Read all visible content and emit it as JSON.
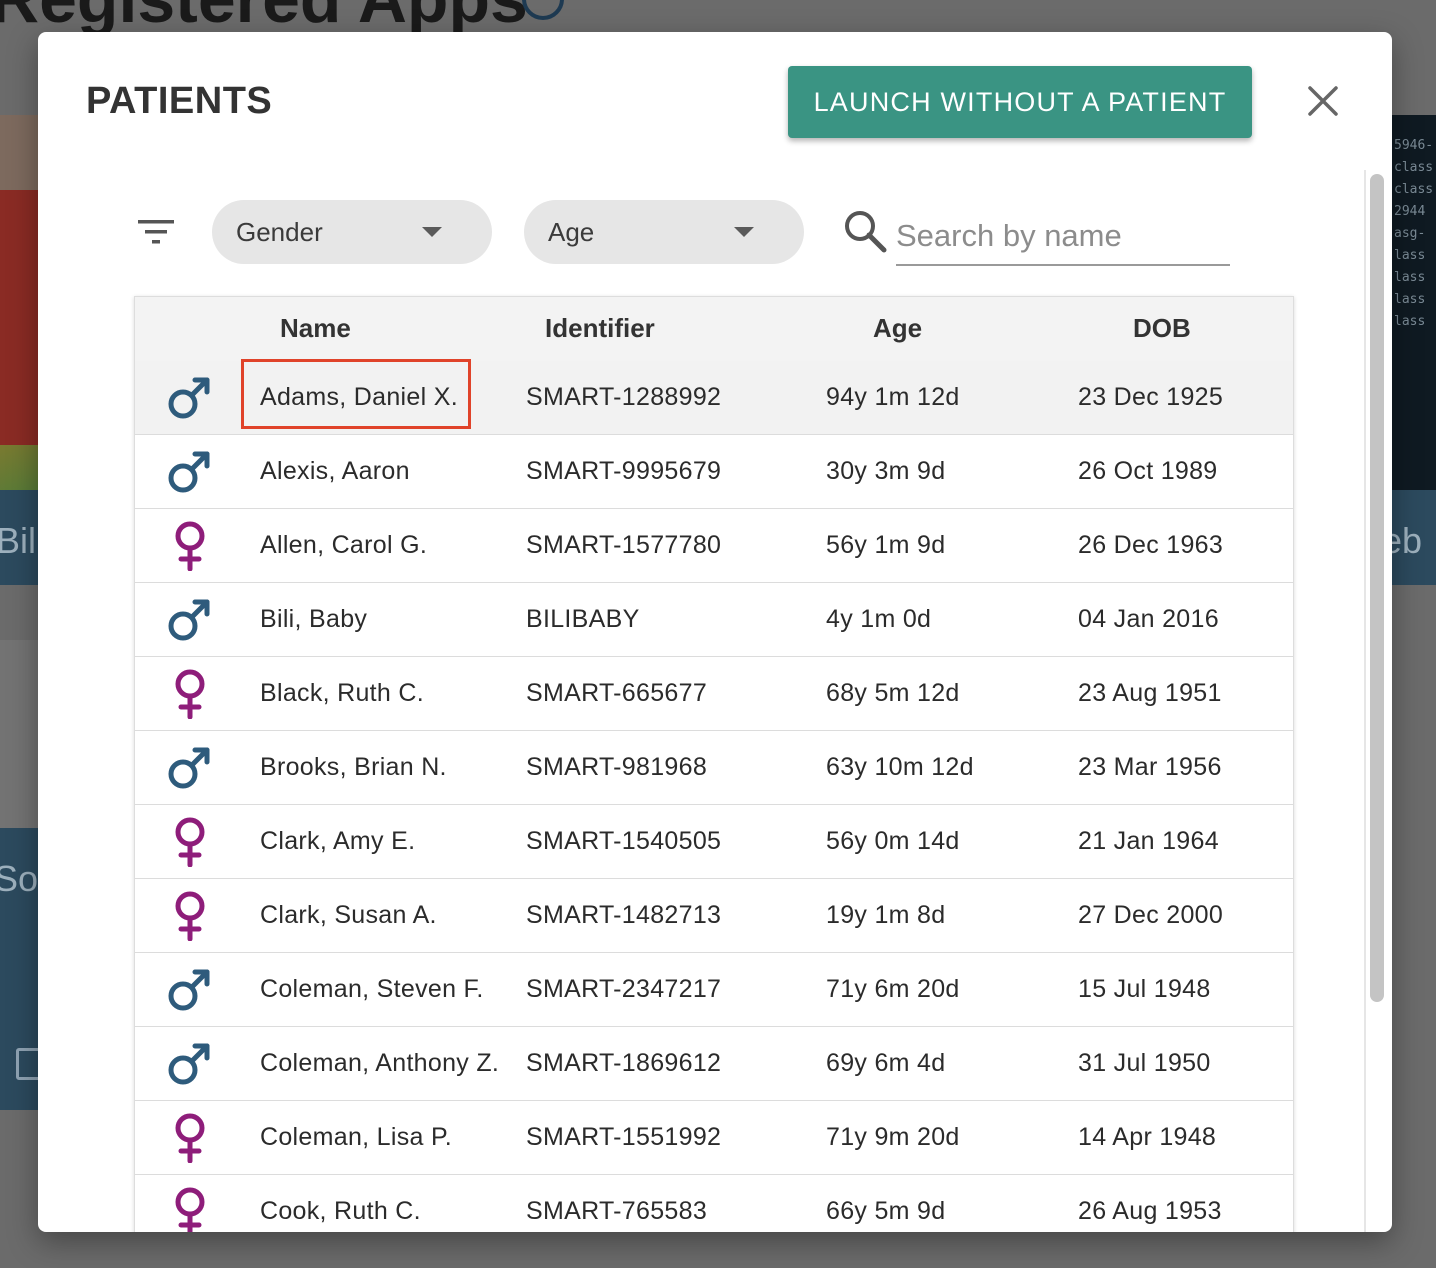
{
  "background": {
    "page_title": "Registered Apps",
    "left_card_label": "Bili",
    "left_card2_label": "Soc",
    "right_card_label": "eb",
    "right_card_code": [
      "5946-",
      "class",
      "class",
      "2944",
      "asg-",
      "lass",
      "lass",
      "lass",
      "lass"
    ]
  },
  "modal": {
    "title": "PATIENTS",
    "launch_button_label": "LAUNCH WITHOUT A PATIENT",
    "close_icon": "close-icon"
  },
  "filters": {
    "filter_icon": "filter-list-icon",
    "gender_label": "Gender",
    "age_label": "Age",
    "search_placeholder": "Search by name",
    "search_value": ""
  },
  "table": {
    "columns": {
      "name": "Name",
      "identifier": "Identifier",
      "age": "Age",
      "dob": "DOB"
    },
    "rows": [
      {
        "gender": "male",
        "name": "Adams, Daniel X.",
        "identifier": "SMART-1288992",
        "age": "94y 1m 12d",
        "dob": "23 Dec 1925"
      },
      {
        "gender": "male",
        "name": "Alexis, Aaron",
        "identifier": "SMART-9995679",
        "age": "30y 3m 9d",
        "dob": "26 Oct 1989"
      },
      {
        "gender": "female",
        "name": "Allen, Carol G.",
        "identifier": "SMART-1577780",
        "age": "56y 1m 9d",
        "dob": "26 Dec 1963"
      },
      {
        "gender": "male",
        "name": "Bili, Baby",
        "identifier": "BILIBABY",
        "age": "4y 1m 0d",
        "dob": "04 Jan 2016"
      },
      {
        "gender": "female",
        "name": "Black, Ruth C.",
        "identifier": "SMART-665677",
        "age": "68y 5m 12d",
        "dob": "23 Aug 1951"
      },
      {
        "gender": "male",
        "name": "Brooks, Brian N.",
        "identifier": "SMART-981968",
        "age": "63y 10m 12d",
        "dob": "23 Mar 1956"
      },
      {
        "gender": "female",
        "name": "Clark, Amy E.",
        "identifier": "SMART-1540505",
        "age": "56y 0m 14d",
        "dob": "21 Jan 1964"
      },
      {
        "gender": "female",
        "name": "Clark, Susan A.",
        "identifier": "SMART-1482713",
        "age": "19y 1m 8d",
        "dob": "27 Dec 2000"
      },
      {
        "gender": "male",
        "name": "Coleman, Steven F.",
        "identifier": "SMART-2347217",
        "age": "71y 6m 20d",
        "dob": "15 Jul 1948"
      },
      {
        "gender": "male",
        "name": "Coleman, Anthony Z.",
        "identifier": "SMART-1869612",
        "age": "69y 6m 4d",
        "dob": "31 Jul 1950"
      },
      {
        "gender": "female",
        "name": "Coleman, Lisa P.",
        "identifier": "SMART-1551992",
        "age": "71y 9m 20d",
        "dob": "14 Apr 1948"
      },
      {
        "gender": "female",
        "name": "Cook, Ruth C.",
        "identifier": "SMART-765583",
        "age": "66y 5m 9d",
        "dob": "26 Aug 1953"
      }
    ],
    "selected_row": 0
  },
  "colors": {
    "accent": "#3a9483",
    "male_icon": "#2e5b7c",
    "female_icon": "#8e1d7a",
    "highlight": "#e0432a"
  }
}
